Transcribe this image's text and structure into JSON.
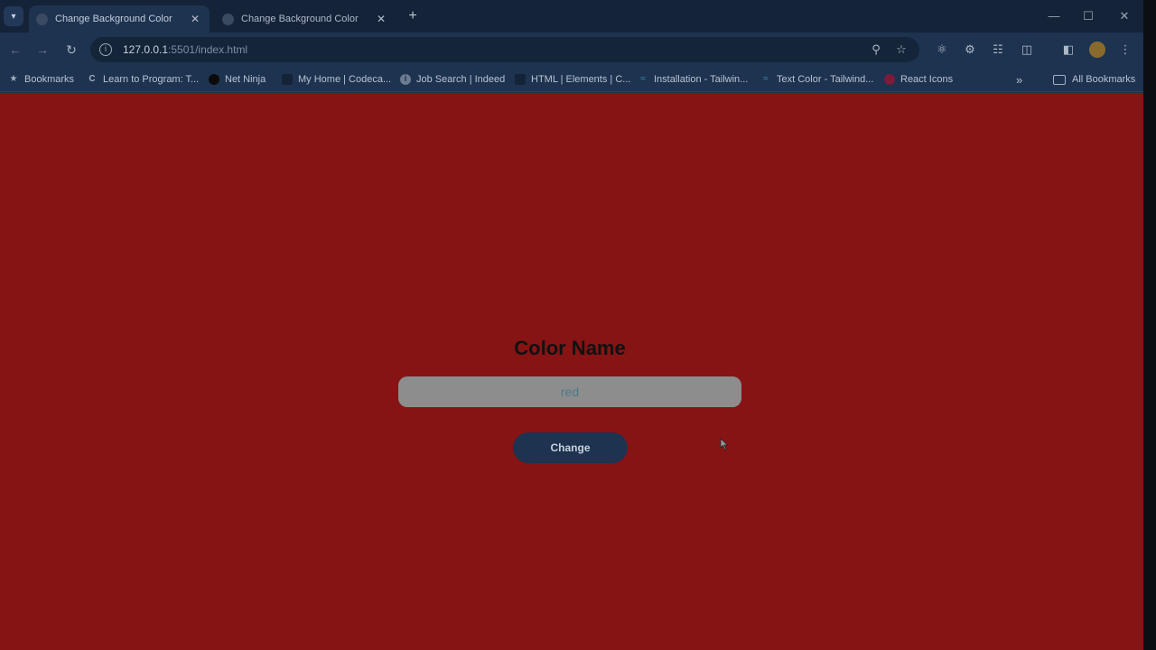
{
  "tabs": [
    {
      "title": "Change Background Color",
      "active": true
    },
    {
      "title": "Change Background Color",
      "active": false
    }
  ],
  "address": {
    "host": "127.0.0.1",
    "path": ":5501/index.html"
  },
  "bookmarks": [
    {
      "label": "Bookmarks",
      "icon": "star-icon"
    },
    {
      "label": "Learn to Program: T...",
      "icon": "codecademy-icon"
    },
    {
      "label": "Net Ninja",
      "icon": "net-ninja-icon"
    },
    {
      "label": "My Home | Codeca...",
      "icon": "codecademy-icon"
    },
    {
      "label": "Job Search | Indeed",
      "icon": "indeed-icon"
    },
    {
      "label": "HTML | Elements | C...",
      "icon": "mdn-icon"
    },
    {
      "label": "Installation - Tailwin...",
      "icon": "tailwind-icon"
    },
    {
      "label": "Text Color - Tailwind...",
      "icon": "tailwind-icon"
    },
    {
      "label": "React Icons",
      "icon": "react-icons-icon"
    }
  ],
  "all_bookmarks": "All Bookmarks",
  "page": {
    "title": "Color Name",
    "input_value": "red",
    "button_label": "Change",
    "background_color": "#861414"
  }
}
